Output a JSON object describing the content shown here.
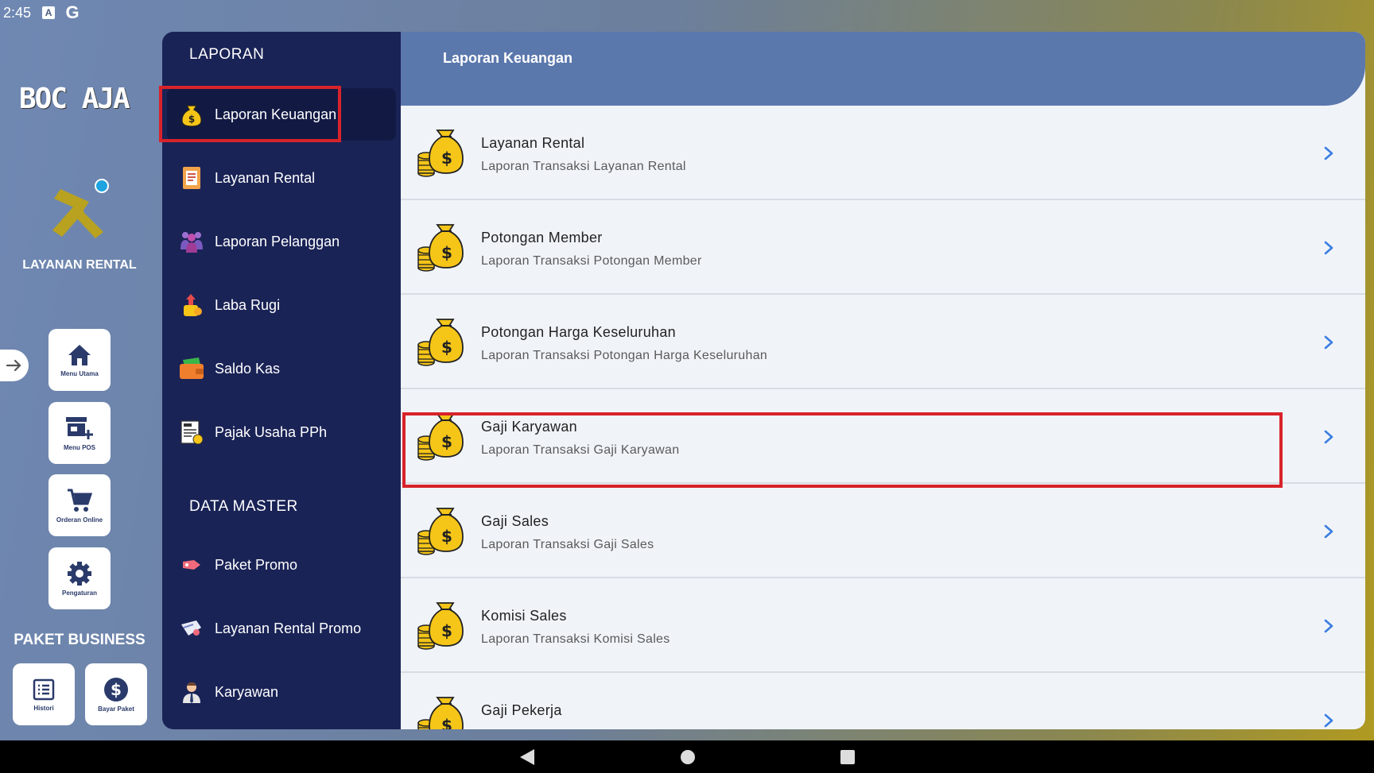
{
  "status_bar": {
    "time": "2:45",
    "icons": [
      "a-icon",
      "google-icon"
    ]
  },
  "brand": {
    "logo_text": "BOC AJA",
    "app_label": "LAYANAN RENTAL"
  },
  "rail": {
    "buttons": [
      {
        "label": "Menu Utama",
        "icon": "home-icon"
      },
      {
        "label": "Menu POS",
        "icon": "store-add-icon"
      },
      {
        "label": "Orderan Online",
        "icon": "cart-icon"
      },
      {
        "label": "Pengaturan",
        "icon": "gear-icon"
      }
    ],
    "paket_title": "PAKET BUSINESS",
    "paket_buttons": [
      {
        "label": "Histori",
        "icon": "list-icon"
      },
      {
        "label": "Bayar Paket",
        "icon": "dollar-icon"
      }
    ]
  },
  "menu": {
    "section_laporan": "LAPORAN",
    "laporan_items": [
      {
        "label": "Laporan Keuangan",
        "icon": "money-bag-icon",
        "active": true
      },
      {
        "label": "Layanan Rental",
        "icon": "document-icon"
      },
      {
        "label": "Laporan Pelanggan",
        "icon": "people-icon"
      },
      {
        "label": "Laba Rugi",
        "icon": "profit-icon"
      },
      {
        "label": "Saldo Kas",
        "icon": "wallet-icon"
      },
      {
        "label": "Pajak Usaha PPh",
        "icon": "tax-icon"
      }
    ],
    "section_master": "DATA MASTER",
    "master_items": [
      {
        "label": "Paket Promo",
        "icon": "tag-icon"
      },
      {
        "label": "Layanan Rental Promo",
        "icon": "promo-icon"
      },
      {
        "label": "Karyawan",
        "icon": "employee-icon"
      }
    ]
  },
  "content": {
    "title": "Laporan Keuangan",
    "rows": [
      {
        "title": "Layanan Rental",
        "subtitle": "Laporan Transaksi Layanan Rental"
      },
      {
        "title": "Potongan Member",
        "subtitle": "Laporan Transaksi Potongan Member"
      },
      {
        "title": "Potongan Harga Keseluruhan",
        "subtitle": "Laporan Transaksi Potongan Harga Keseluruhan"
      },
      {
        "title": "Gaji Karyawan",
        "subtitle": "Laporan Transaksi Gaji Karyawan"
      },
      {
        "title": "Gaji Sales",
        "subtitle": "Laporan Transaksi Gaji Sales"
      },
      {
        "title": "Komisi Sales",
        "subtitle": "Laporan Transaksi Komisi Sales"
      },
      {
        "title": "Gaji Pekerja",
        "subtitle": ""
      }
    ]
  },
  "colors": {
    "menu_bg": "#1a2356",
    "header_bg": "#5b78ad",
    "highlight": "#d8232a",
    "chevron": "#3b7de0",
    "money_yellow": "#f5c518"
  }
}
